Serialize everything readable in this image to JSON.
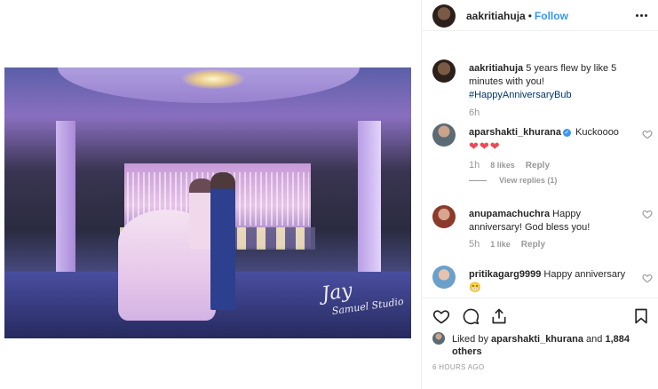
{
  "post": {
    "username": "aakritiahuja",
    "follow_label": "Follow",
    "separator": "•",
    "caption": "5 years flew by like 5 minutes with you!",
    "hashtag": "#HappyAnniversaryBub",
    "caption_time": "6h",
    "watermark": "Jay",
    "watermark_sub": "Samuel Studio"
  },
  "comments": [
    {
      "username": "aparshakti_khurana",
      "verified": true,
      "text": "Kuckoooo",
      "hearts": "❤❤❤",
      "time": "1h",
      "likes": "8 likes",
      "reply_label": "Reply",
      "view_replies": "View replies (1)"
    },
    {
      "username": "anupamachuchra",
      "text": "Happy anniversary! God bless you!",
      "time": "5h",
      "likes": "1 like",
      "reply_label": "Reply"
    },
    {
      "username": "pritikagarg9999",
      "text": "Happy anniversary",
      "emoji": "😁"
    }
  ],
  "liked_by": {
    "prefix": "Liked by",
    "user": "aparshakti_khurana",
    "middle": "and",
    "count": "1,884 others"
  },
  "posted_time": "6 HOURS AGO",
  "colors": {
    "accent": "#3897f0",
    "heart": "#ed4956",
    "muted": "#999999",
    "border": "#efefef"
  }
}
